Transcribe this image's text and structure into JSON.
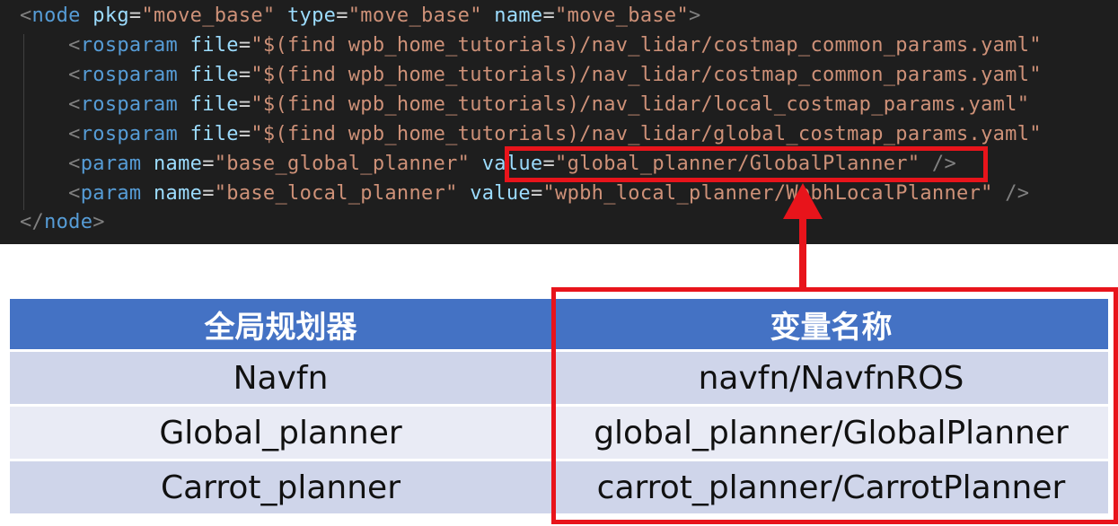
{
  "code": {
    "lines": [
      {
        "tokens": [
          {
            "t": "<",
            "c": "punc"
          },
          {
            "t": "node",
            "c": "tag"
          },
          {
            "t": " ",
            "c": "eq"
          },
          {
            "t": "pkg",
            "c": "attr"
          },
          {
            "t": "=",
            "c": "eq"
          },
          {
            "t": "\"move_base\"",
            "c": "str"
          },
          {
            "t": " ",
            "c": "eq"
          },
          {
            "t": "type",
            "c": "attr"
          },
          {
            "t": "=",
            "c": "eq"
          },
          {
            "t": "\"move_base\"",
            "c": "str"
          },
          {
            "t": " ",
            "c": "eq"
          },
          {
            "t": "name",
            "c": "attr"
          },
          {
            "t": "=",
            "c": "eq"
          },
          {
            "t": "\"move_base\"",
            "c": "str"
          },
          {
            "t": ">",
            "c": "punc"
          }
        ]
      },
      {
        "tokens": [
          {
            "t": "    <",
            "c": "punc"
          },
          {
            "t": "rosparam",
            "c": "tag"
          },
          {
            "t": " ",
            "c": "eq"
          },
          {
            "t": "file",
            "c": "attr"
          },
          {
            "t": "=",
            "c": "eq"
          },
          {
            "t": "\"$(find wpb_home_tutorials)/nav_lidar/costmap_common_params.yaml\"",
            "c": "str"
          }
        ]
      },
      {
        "tokens": [
          {
            "t": "    <",
            "c": "punc"
          },
          {
            "t": "rosparam",
            "c": "tag"
          },
          {
            "t": " ",
            "c": "eq"
          },
          {
            "t": "file",
            "c": "attr"
          },
          {
            "t": "=",
            "c": "eq"
          },
          {
            "t": "\"$(find wpb_home_tutorials)/nav_lidar/costmap_common_params.yaml\"",
            "c": "str"
          }
        ]
      },
      {
        "tokens": [
          {
            "t": "    <",
            "c": "punc"
          },
          {
            "t": "rosparam",
            "c": "tag"
          },
          {
            "t": " ",
            "c": "eq"
          },
          {
            "t": "file",
            "c": "attr"
          },
          {
            "t": "=",
            "c": "eq"
          },
          {
            "t": "\"$(find wpb_home_tutorials)/nav_lidar/local_costmap_params.yaml\"",
            "c": "str"
          }
        ]
      },
      {
        "tokens": [
          {
            "t": "    <",
            "c": "punc"
          },
          {
            "t": "rosparam",
            "c": "tag"
          },
          {
            "t": " ",
            "c": "eq"
          },
          {
            "t": "file",
            "c": "attr"
          },
          {
            "t": "=",
            "c": "eq"
          },
          {
            "t": "\"$(find wpb_home_tutorials)/nav_lidar/global_costmap_params.yaml\"",
            "c": "str"
          }
        ]
      },
      {
        "tokens": [
          {
            "t": "    <",
            "c": "punc"
          },
          {
            "t": "param",
            "c": "tag"
          },
          {
            "t": " ",
            "c": "eq"
          },
          {
            "t": "name",
            "c": "attr"
          },
          {
            "t": "=",
            "c": "eq"
          },
          {
            "t": "\"base_global_planner\"",
            "c": "str"
          },
          {
            "t": " ",
            "c": "eq"
          },
          {
            "t": "value",
            "c": "attr"
          },
          {
            "t": "=",
            "c": "eq"
          },
          {
            "t": "\"global_planner/GlobalPlanner\"",
            "c": "str"
          },
          {
            "t": " />",
            "c": "punc"
          }
        ]
      },
      {
        "tokens": [
          {
            "t": "    <",
            "c": "punc"
          },
          {
            "t": "param",
            "c": "tag"
          },
          {
            "t": " ",
            "c": "eq"
          },
          {
            "t": "name",
            "c": "attr"
          },
          {
            "t": "=",
            "c": "eq"
          },
          {
            "t": "\"base_local_planner\"",
            "c": "str"
          },
          {
            "t": " ",
            "c": "eq"
          },
          {
            "t": "value",
            "c": "attr"
          },
          {
            "t": "=",
            "c": "eq"
          },
          {
            "t": "\"wpbh_local_planner/WpbhLocalPlanner\"",
            "c": "str"
          },
          {
            "t": " />",
            "c": "punc"
          }
        ]
      },
      {
        "tokens": [
          {
            "t": "</",
            "c": "punc"
          },
          {
            "t": "node",
            "c": "tag"
          },
          {
            "t": ">",
            "c": "punc"
          }
        ]
      }
    ]
  },
  "colors": {
    "code_background": "#1e1e1e",
    "tag": "#569cd6",
    "attribute": "#9cdcfe",
    "string": "#ce9178",
    "punctuation": "#808080",
    "highlight": "#e8141b",
    "table_header": "#4472c4",
    "table_row_odd": "#cfd5ea",
    "table_row_even": "#e9ebf5"
  },
  "table": {
    "headers": [
      "全局规划器",
      "变量名称"
    ],
    "rows": [
      [
        "Navfn",
        "navfn/NavfnROS"
      ],
      [
        "Global_planner",
        "global_planner/GlobalPlanner"
      ],
      [
        "Carrot_planner",
        "carrot_planner/CarrotPlanner"
      ]
    ]
  }
}
